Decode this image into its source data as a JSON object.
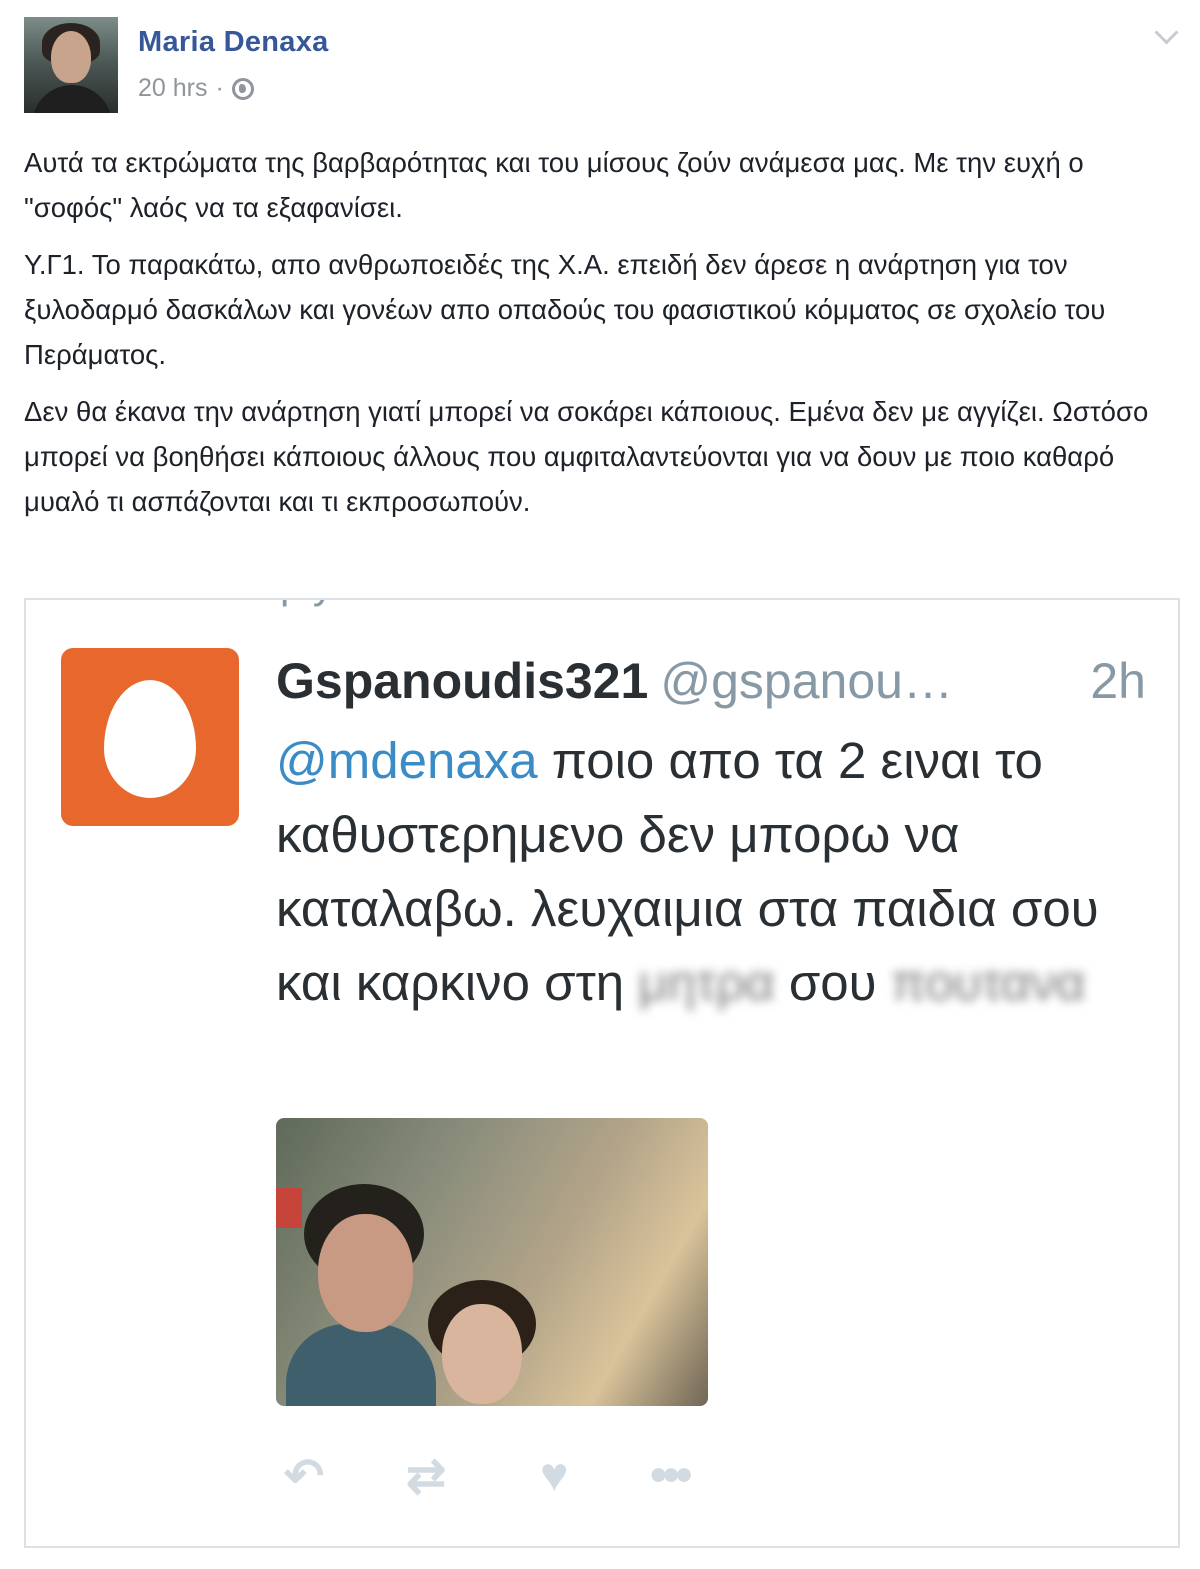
{
  "post": {
    "author": "Maria Denaxa",
    "time": "20 hrs",
    "separator": "·",
    "privacy_icon": "globe-icon",
    "paragraphs": [
      "Αυτά τα εκτρώματα της βαρβαρότητας και του μίσους ζούν ανάμεσα μας. Με την ευχή ο \"σοφός\" λαός να τα εξαφανίσει.",
      "Υ.Γ1. Το παρακάτω, απο ανθρωποειδές της Χ.Α. επειδή δεν άρεσε η ανάρτηση για τον ξυλοδαρμό δασκάλων και γονέων απο οπαδούς του φασιστικού κόμματος σε σχολείο του Περάματος.",
      "Δεν θα έκανα την ανάρτηση γιατί μπορεί να σοκάρει κάποιους. Εμένα δεν με αγγίζει. Ωστόσο μπορεί να βοηθήσει κάποιους άλλους που αμφιταλαντεύονται για να δουν με ποιο καθαρό μυαλό τι ασπάζονται και τι εκπροσωπούν."
    ]
  },
  "tweet": {
    "cut_header": "In reply to Maria Denaxa",
    "name": "Gspanoudis321",
    "handle": "@gspanou…",
    "time": "2h",
    "mention": "@mdenaxa",
    "text": " ποιο απο τα 2 ειναι το καθυστερημενο δεν μπορω να καταλαβω. λευχαιμια στα παιδια σου και καρκινο στη ",
    "blurred_1": "μητρα",
    "text_2": " σου ",
    "blurred_2": "πουτανα",
    "actions": [
      "reply-icon",
      "retweet-icon",
      "heart-icon",
      "more-icon"
    ],
    "accent_color": "#3a8bc6",
    "egg_color": "#e8672c"
  }
}
